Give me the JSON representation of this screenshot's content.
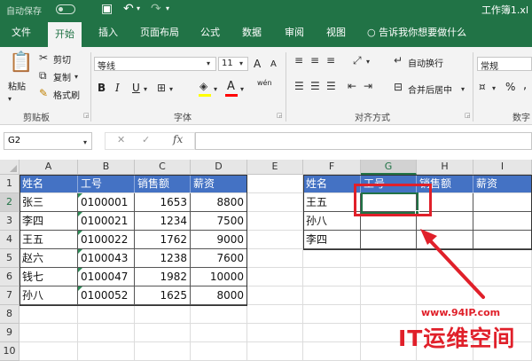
{
  "titlebar": {
    "autosave_label": "自动保存",
    "save_icon": "save-icon",
    "undo_icon": "undo-icon",
    "redo_icon": "redo-icon",
    "window_title": "工作簿1.xl"
  },
  "tabs": [
    "文件",
    "开始",
    "插入",
    "页面布局",
    "公式",
    "数据",
    "审阅",
    "视图"
  ],
  "active_tab": "开始",
  "tell_me": "告诉我你想要做什么",
  "ribbon": {
    "clipboard": {
      "paste": "粘贴",
      "cut": "剪切",
      "copy": "复制",
      "format_painter": "格式刷",
      "group_label": "剪贴板"
    },
    "font": {
      "font_name": "等线",
      "font_size": "11",
      "grow": "A",
      "shrink": "A",
      "bold": "B",
      "italic": "I",
      "underline": "U",
      "font_color_letter": "A",
      "phonetic": "wén",
      "group_label": "字体",
      "fill_color": "#ffff00",
      "font_color": "#ff0000"
    },
    "alignment": {
      "wrap_text": "自动换行",
      "merge_center": "合并后居中",
      "group_label": "对齐方式"
    },
    "number": {
      "format": "常规",
      "percent": "%",
      "comma": ",",
      "group_label": "数字"
    }
  },
  "formula_bar": {
    "name_box": "G2",
    "cancel": "✕",
    "enter": "✓",
    "fx": "fx",
    "value": ""
  },
  "sheet": {
    "columns": [
      "A",
      "B",
      "C",
      "D",
      "E",
      "F",
      "G",
      "H",
      "I"
    ],
    "rows": [
      "1",
      "2",
      "3",
      "4",
      "5",
      "6",
      "7",
      "8",
      "9",
      "10"
    ],
    "selected_cell": "G2",
    "accent": "#217346",
    "table_header_color": "#4472c4",
    "left_table": {
      "headers": [
        "姓名",
        "工号",
        "销售额",
        "薪资"
      ],
      "rows": [
        [
          "张三",
          "0100001",
          "1653",
          "8800"
        ],
        [
          "李四",
          "0100021",
          "1234",
          "7500"
        ],
        [
          "王五",
          "0100022",
          "1762",
          "9000"
        ],
        [
          "赵六",
          "0100043",
          "1238",
          "7600"
        ],
        [
          "钱七",
          "0100047",
          "1982",
          "10000"
        ],
        [
          "孙八",
          "0100052",
          "1625",
          "8000"
        ]
      ]
    },
    "right_table": {
      "headers": [
        "姓名",
        "工号",
        "销售额",
        "薪资"
      ],
      "rows": [
        [
          "王五",
          "",
          "",
          ""
        ],
        [
          "孙八",
          "",
          "",
          ""
        ],
        [
          "李四",
          "",
          "",
          ""
        ]
      ]
    },
    "highlight_color": "#e0202a"
  },
  "watermark": {
    "site": "www.94IP.com",
    "brand": "IT运维空间"
  }
}
